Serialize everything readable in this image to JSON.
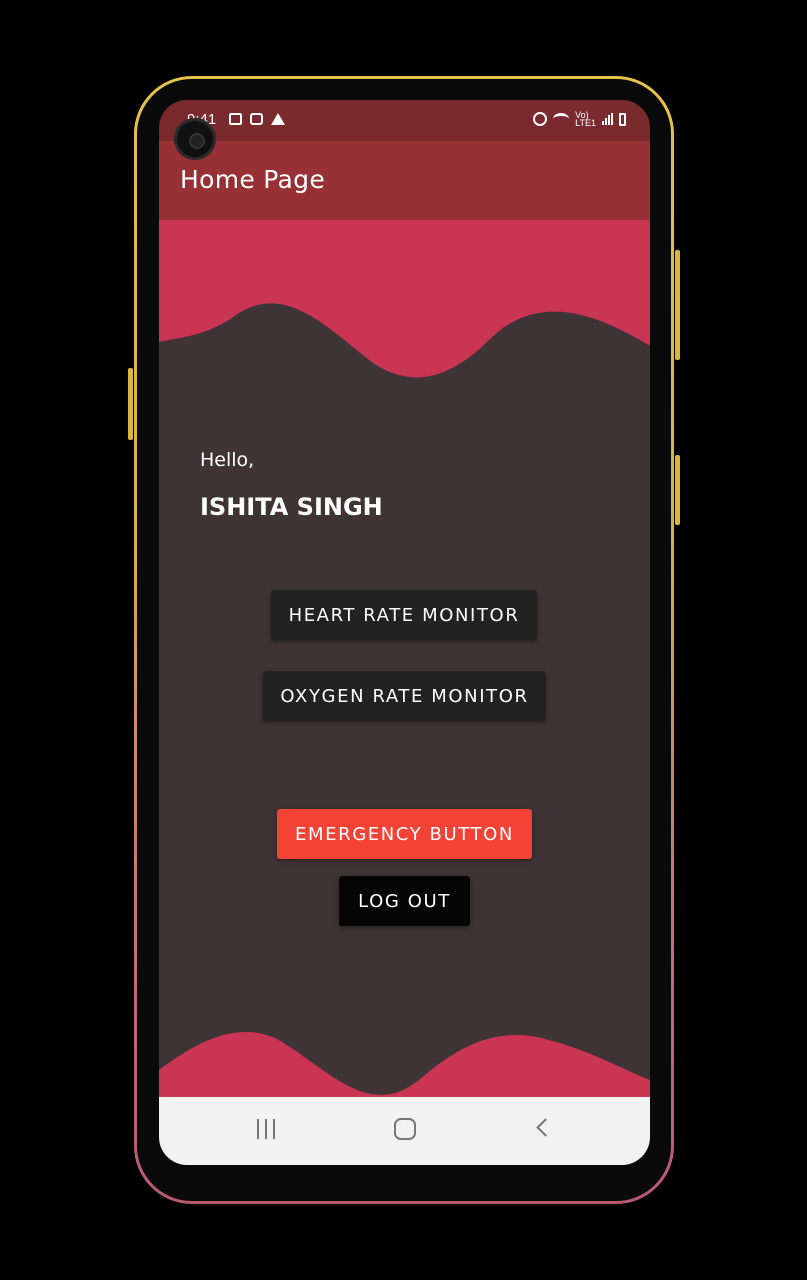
{
  "status_bar": {
    "time": "9:41",
    "left_icons": [
      "image-icon",
      "sd-card-icon",
      "warning-icon"
    ],
    "right_icons": [
      "alarm-icon",
      "wifi-icon",
      "volte-icon",
      "signal-icon",
      "battery-icon"
    ],
    "volte_label": "Vo)\nLTE1"
  },
  "app_bar": {
    "title": "Home Page",
    "color": "#973135"
  },
  "main": {
    "greeting": "Hello,",
    "user_name": "ISHITA SINGH",
    "buttons": {
      "heart_rate": "HEART RATE MONITOR",
      "oxygen_rate": "OXYGEN RATE MONITOR",
      "emergency": "EMERGENCY BUTTON",
      "logout": "LOG OUT"
    }
  },
  "colors": {
    "wave": "#c93552",
    "background": "#3e3335",
    "emergency": "#f44336",
    "status_bar": "#7a2a2d"
  },
  "nav_bar": {
    "items": [
      "recent-apps-icon",
      "home-icon",
      "back-icon"
    ]
  }
}
